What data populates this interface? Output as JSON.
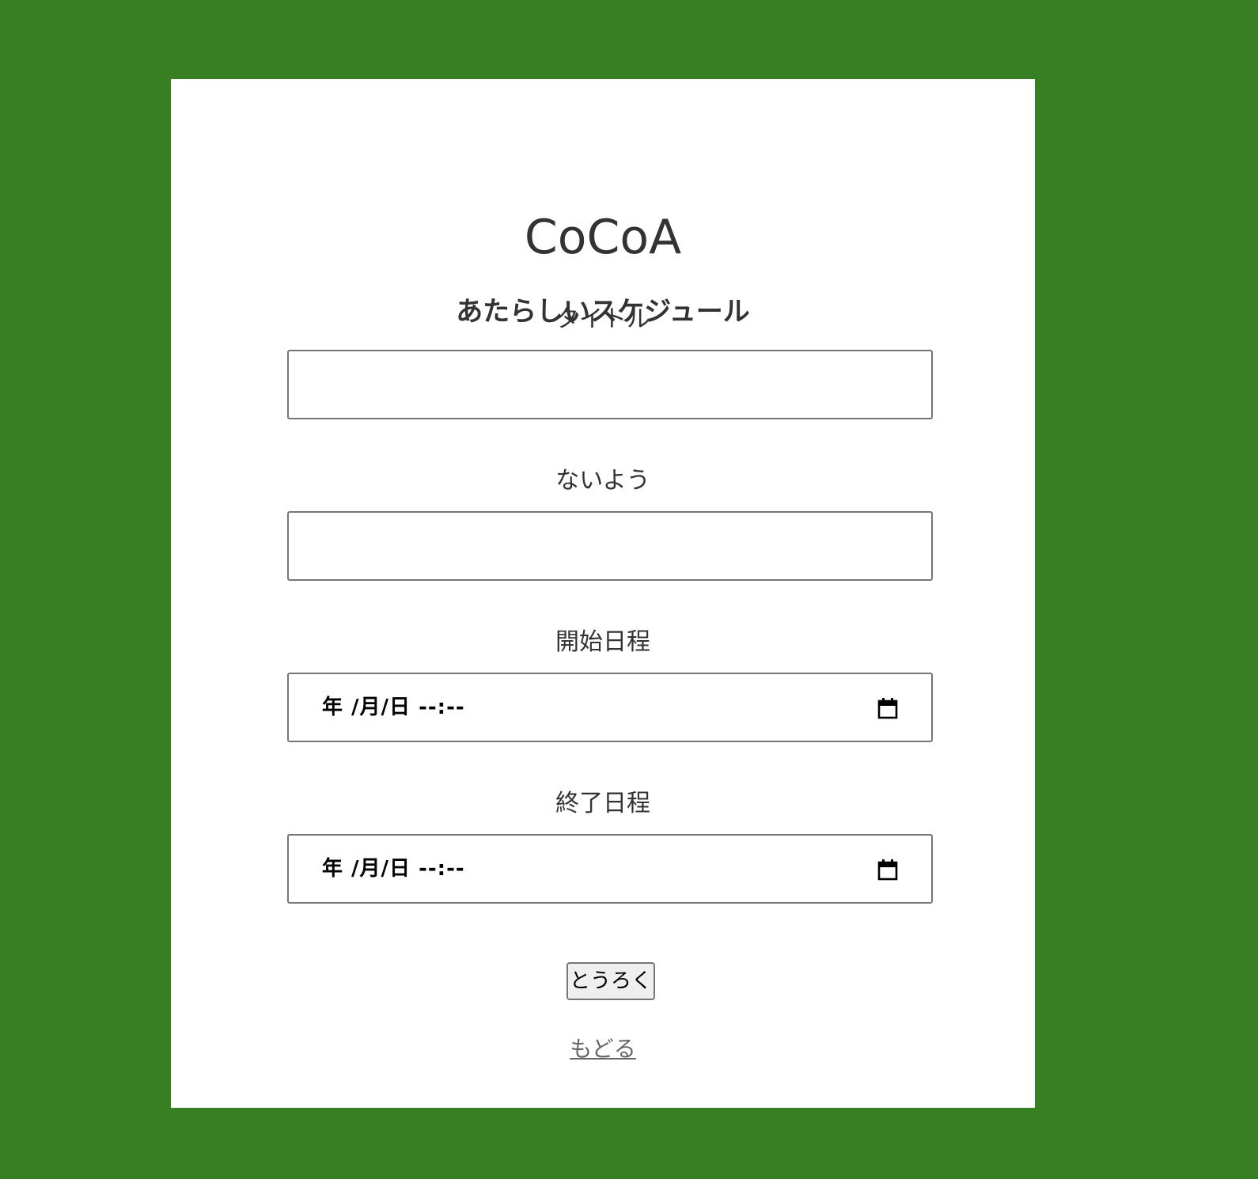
{
  "app": {
    "title": "CoCoA"
  },
  "page": {
    "subtitle": "あたらしいスケジュール"
  },
  "form": {
    "title_label": "タイトル",
    "title_value": "",
    "content_label": "ないよう",
    "content_value": "",
    "start_label": "開始日程",
    "start_value": "年 /月/日 --:--",
    "end_label": "終了日程",
    "end_value": "年 /月/日 --:--",
    "submit_label": "とうろく"
  },
  "nav": {
    "back_label": "もどる"
  },
  "colors": {
    "background": "#387e22",
    "card": "#ffffff",
    "text": "#333333"
  },
  "icons": {
    "date_picker": "calendar-icon"
  }
}
